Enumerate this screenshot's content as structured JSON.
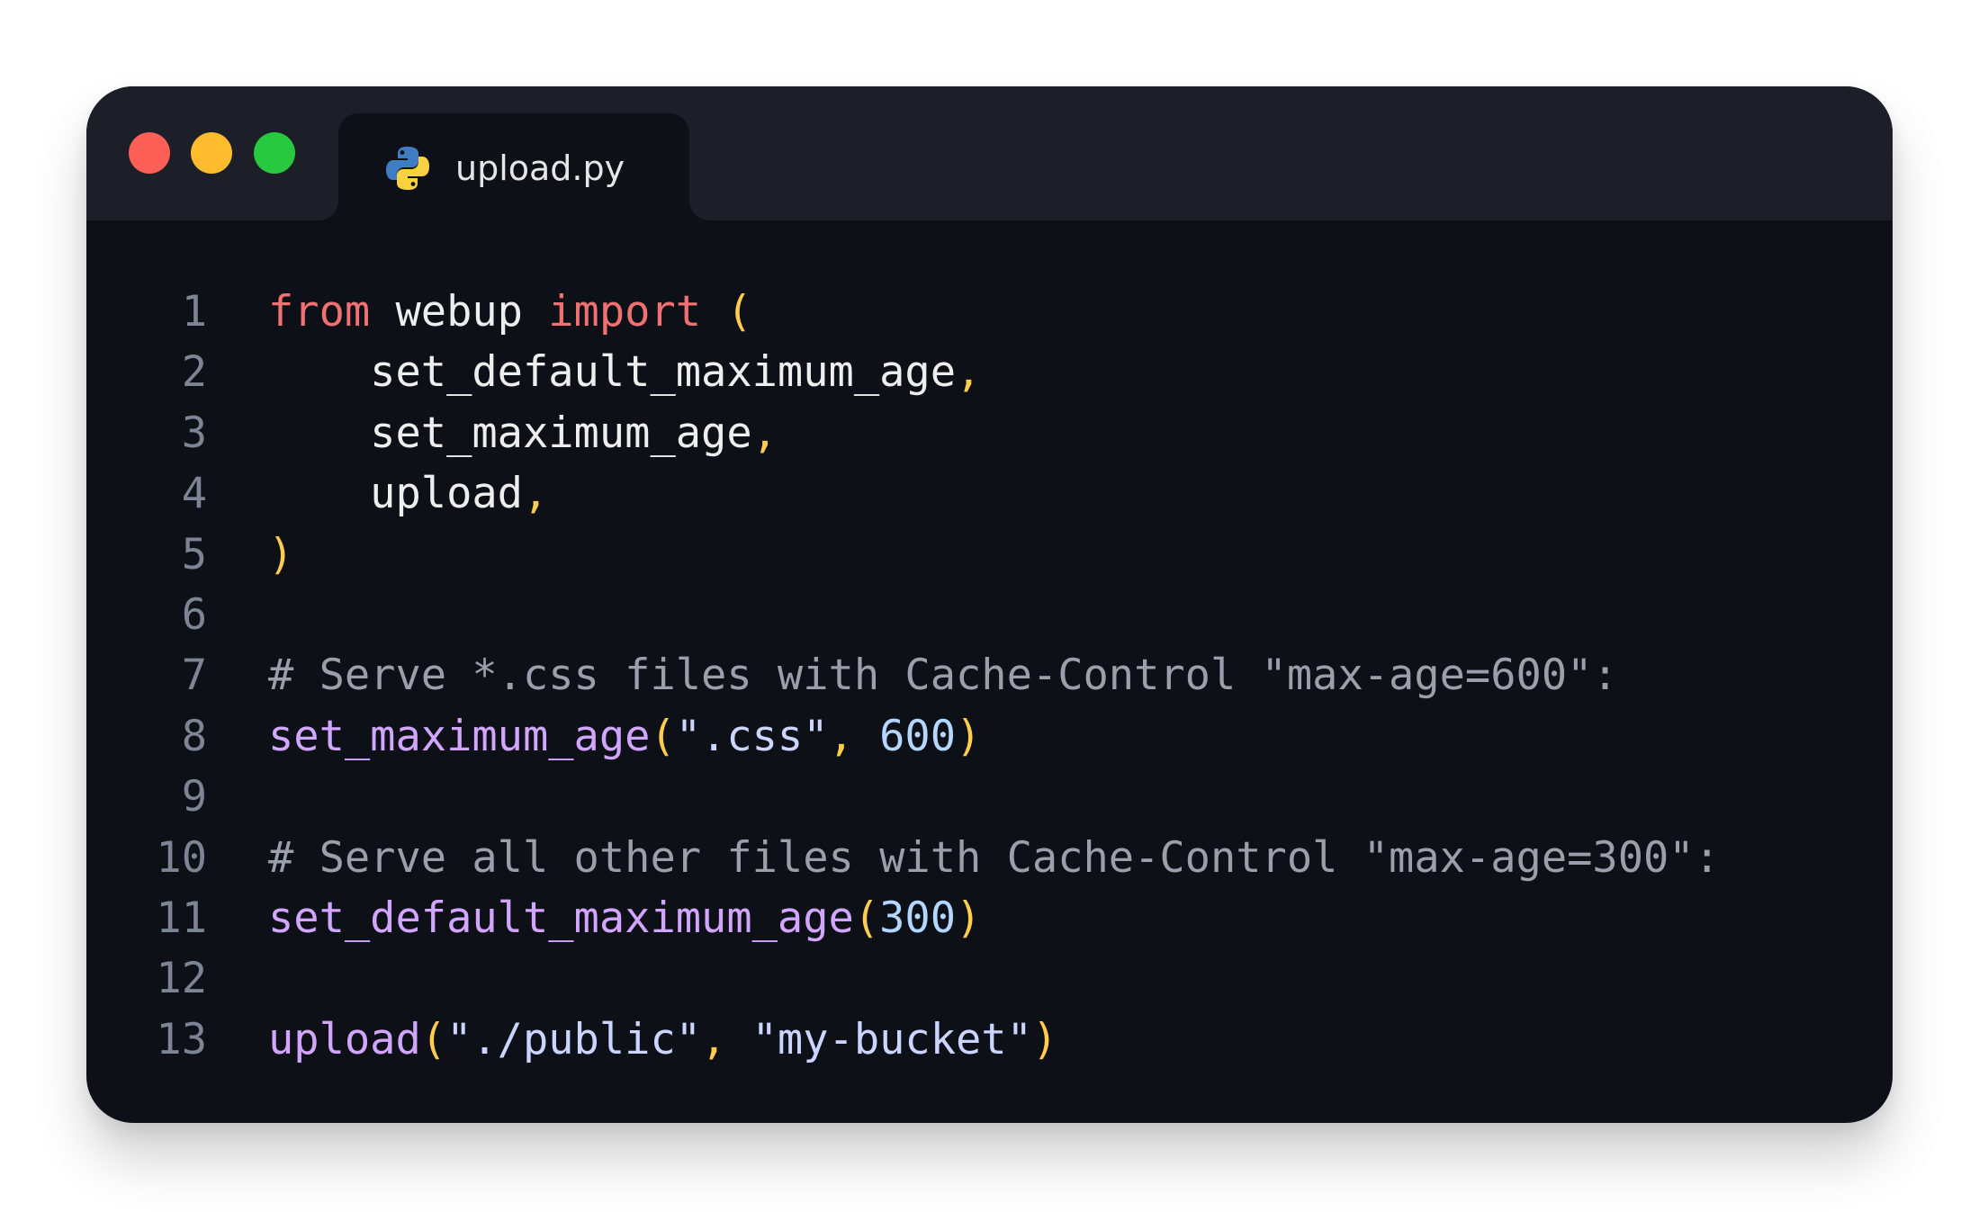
{
  "window": {
    "tab": {
      "filename": "upload.py",
      "icon": "python-icon"
    },
    "traffic_lights": {
      "close_color": "#fe5f57",
      "minimize_color": "#febc2e",
      "maximize_color": "#28c840"
    }
  },
  "colors": {
    "keyword": "#f07171",
    "plain": "#eeeeee",
    "punct": "#ffcc4d",
    "comment": "#9b9fab",
    "func": "#d2a6ff",
    "string": "#cbd5ff",
    "number": "#b3d7ff",
    "line_number": "#7d8494",
    "background": "#0d1017",
    "titlebar": "#1c1f27"
  },
  "code_lines": [
    {
      "number": "1",
      "tokens": [
        {
          "t": "keyword",
          "v": "from"
        },
        {
          "t": "plain",
          "v": " webup "
        },
        {
          "t": "keyword",
          "v": "import"
        },
        {
          "t": "plain",
          "v": " "
        },
        {
          "t": "punct",
          "v": "("
        }
      ]
    },
    {
      "number": "2",
      "tokens": [
        {
          "t": "plain",
          "v": "    set_default_maximum_age"
        },
        {
          "t": "punct",
          "v": ","
        }
      ]
    },
    {
      "number": "3",
      "tokens": [
        {
          "t": "plain",
          "v": "    set_maximum_age"
        },
        {
          "t": "punct",
          "v": ","
        }
      ]
    },
    {
      "number": "4",
      "tokens": [
        {
          "t": "plain",
          "v": "    upload"
        },
        {
          "t": "punct",
          "v": ","
        }
      ]
    },
    {
      "number": "5",
      "tokens": [
        {
          "t": "punct",
          "v": ")"
        }
      ]
    },
    {
      "number": "6",
      "tokens": []
    },
    {
      "number": "7",
      "tokens": [
        {
          "t": "comment",
          "v": "# Serve *.css files with Cache-Control \"max-age=600\":"
        }
      ]
    },
    {
      "number": "8",
      "tokens": [
        {
          "t": "func",
          "v": "set_maximum_age"
        },
        {
          "t": "punct",
          "v": "("
        },
        {
          "t": "string",
          "v": "\".css\""
        },
        {
          "t": "punct",
          "v": ","
        },
        {
          "t": "plain",
          "v": " "
        },
        {
          "t": "number",
          "v": "600"
        },
        {
          "t": "punct",
          "v": ")"
        }
      ]
    },
    {
      "number": "9",
      "tokens": []
    },
    {
      "number": "10",
      "tokens": [
        {
          "t": "comment",
          "v": "# Serve all other files with Cache-Control \"max-age=300\":"
        }
      ]
    },
    {
      "number": "11",
      "tokens": [
        {
          "t": "func",
          "v": "set_default_maximum_age"
        },
        {
          "t": "punct",
          "v": "("
        },
        {
          "t": "number",
          "v": "300"
        },
        {
          "t": "punct",
          "v": ")"
        }
      ]
    },
    {
      "number": "12",
      "tokens": []
    },
    {
      "number": "13",
      "tokens": [
        {
          "t": "func",
          "v": "upload"
        },
        {
          "t": "punct",
          "v": "("
        },
        {
          "t": "string",
          "v": "\"./public\""
        },
        {
          "t": "punct",
          "v": ","
        },
        {
          "t": "plain",
          "v": " "
        },
        {
          "t": "string",
          "v": "\"my-bucket\""
        },
        {
          "t": "punct",
          "v": ")"
        }
      ]
    }
  ]
}
